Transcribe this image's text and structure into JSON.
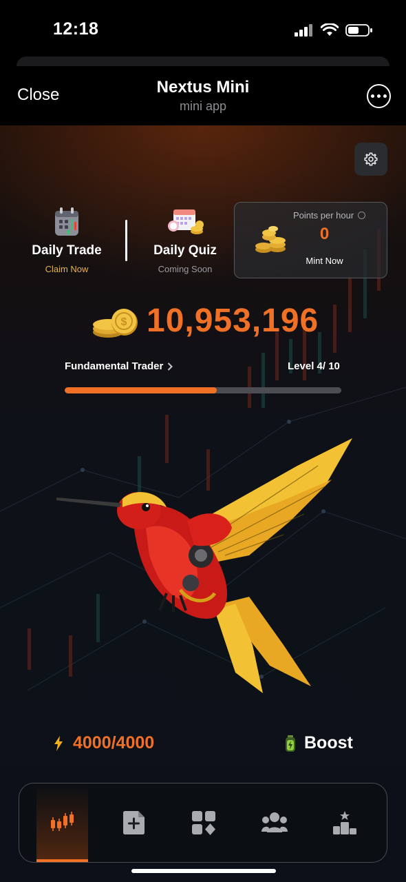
{
  "status_bar": {
    "time": "12:18"
  },
  "nav": {
    "close_label": "Close",
    "title": "Nextus Mini",
    "subtitle": "mini app"
  },
  "tasks": {
    "daily_trade": {
      "title": "Daily Trade",
      "status": "Claim Now"
    },
    "daily_quiz": {
      "title": "Daily Quiz",
      "status": "Coming Soon"
    }
  },
  "points_card": {
    "label": "Points per hour",
    "value": "0",
    "action": "Mint Now"
  },
  "balance": {
    "value": "10,953,196"
  },
  "progress": {
    "rank": "Fundamental Trader",
    "level_text": "Level 4/ 10",
    "fraction": 0.55
  },
  "energy": {
    "value": "4000/4000"
  },
  "boost": {
    "label": "Boost"
  },
  "bottom_nav": {
    "tabs": [
      {
        "icon": "candlestick-chart-icon",
        "active": true
      },
      {
        "icon": "add-document-icon",
        "active": false
      },
      {
        "icon": "apps-grid-icon",
        "active": false
      },
      {
        "icon": "friends-group-icon",
        "active": false
      },
      {
        "icon": "leaderboard-podium-icon",
        "active": false
      }
    ]
  },
  "colors": {
    "accent": "#f07026",
    "claim": "#e5b24b",
    "background": "#0c1119"
  }
}
